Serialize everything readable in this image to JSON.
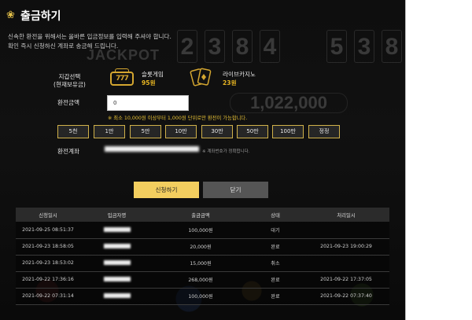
{
  "header": {
    "title": "출금하기",
    "icon": "coins-icon",
    "desc1": "신속한 환전을 위해서는 올바른 입금정보를 입력해 주셔야 합니다.",
    "desc2": "확인 즉시 신청하신 계좌로 송금해 드립니다."
  },
  "background": {
    "jackpot_word": "JACKPOT",
    "jackpot_digits": [
      "2",
      "3",
      "8",
      "4",
      "5",
      "3",
      "8"
    ],
    "jackpot_amount": "1,022,000"
  },
  "wallet": {
    "label_line1": "지갑선택",
    "label_line2": "(현재보유금)",
    "slot": {
      "name": "슬롯게임",
      "amount": "95원",
      "icon": "slot-machine-icon"
    },
    "casino": {
      "name": "라이브카지노",
      "amount": "23원",
      "icon": "playing-cards-icon"
    }
  },
  "exchange": {
    "label": "환전금액",
    "value": "0",
    "note": "※ 최소 10,000원 이상부터 1,000원 단위로만 환전이 가능합니다.",
    "buttons": [
      "5천",
      "1만",
      "5만",
      "10만",
      "30만",
      "50만",
      "100만",
      "정정"
    ]
  },
  "account": {
    "label": "환전계좌",
    "note": "※ 계좌번호가 정확합니다."
  },
  "actions": {
    "apply": "신청하기",
    "close": "닫기"
  },
  "history": {
    "headers": [
      "신청일시",
      "입금자명",
      "출금금액",
      "상태",
      "처리일시"
    ],
    "rows": [
      {
        "requested": "2021-09-25 08:51:37",
        "amount": "100,000원",
        "status": "대기",
        "processed": ""
      },
      {
        "requested": "2021-09-23 18:58:05",
        "amount": "20,000원",
        "status": "완료",
        "processed": "2021-09-23 19:00:29"
      },
      {
        "requested": "2021-09-23 18:53:02",
        "amount": "15,000원",
        "status": "취소",
        "processed": ""
      },
      {
        "requested": "2021-09-22 17:36:16",
        "amount": "268,000원",
        "status": "완료",
        "processed": "2021-09-22 17:37:05"
      },
      {
        "requested": "2021-09-22 07:31:14",
        "amount": "100,000원",
        "status": "완료",
        "processed": "2021-09-22 07:37:40"
      }
    ]
  },
  "colors": {
    "accent_gold": "#f3ce5f",
    "note_yellow": "#e6c035",
    "button_border": "#d0b14a"
  }
}
